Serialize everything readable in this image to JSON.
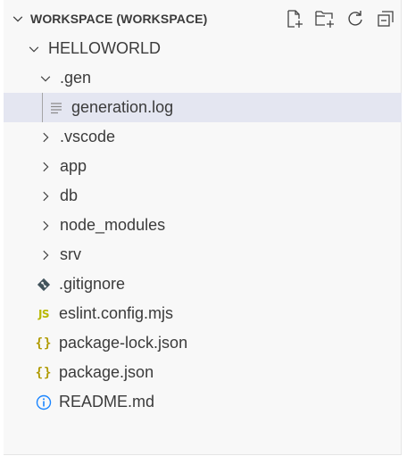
{
  "explorer": {
    "section_title": "WORKSPACE (WORKSPACE)",
    "actions": [
      {
        "name": "new-file",
        "icon": "new-file-icon"
      },
      {
        "name": "new-folder",
        "icon": "new-folder-icon"
      },
      {
        "name": "refresh",
        "icon": "refresh-icon"
      },
      {
        "name": "collapse-all",
        "icon": "collapse-all-icon"
      }
    ]
  },
  "tree": {
    "root": {
      "label": "HELLOWORLD",
      "expanded": true
    },
    "gen_folder": {
      "label": ".gen",
      "expanded": true
    },
    "generation_log": {
      "label": "generation.log",
      "selected": true
    },
    "folders": [
      {
        "label": ".vscode",
        "expanded": false
      },
      {
        "label": "app",
        "expanded": false
      },
      {
        "label": "db",
        "expanded": false
      },
      {
        "label": "node_modules",
        "expanded": false
      },
      {
        "label": "srv",
        "expanded": false
      }
    ],
    "files": [
      {
        "label": ".gitignore",
        "icon": "git-icon"
      },
      {
        "label": "eslint.config.mjs",
        "icon": "js-icon",
        "icon_text": "JS"
      },
      {
        "label": "package-lock.json",
        "icon": "json-icon",
        "icon_text": "{}"
      },
      {
        "label": "package.json",
        "icon": "json-icon",
        "icon_text": "{}"
      },
      {
        "label": "README.md",
        "icon": "info-icon"
      }
    ]
  },
  "colors": {
    "background": "#f8f8f8",
    "selection": "#e4e6f1",
    "text": "#3b3b3b",
    "js_icon": "#b8b800",
    "json_icon": "#b09a00",
    "info_icon": "#1a85ff",
    "git_icon": "#41535b"
  }
}
